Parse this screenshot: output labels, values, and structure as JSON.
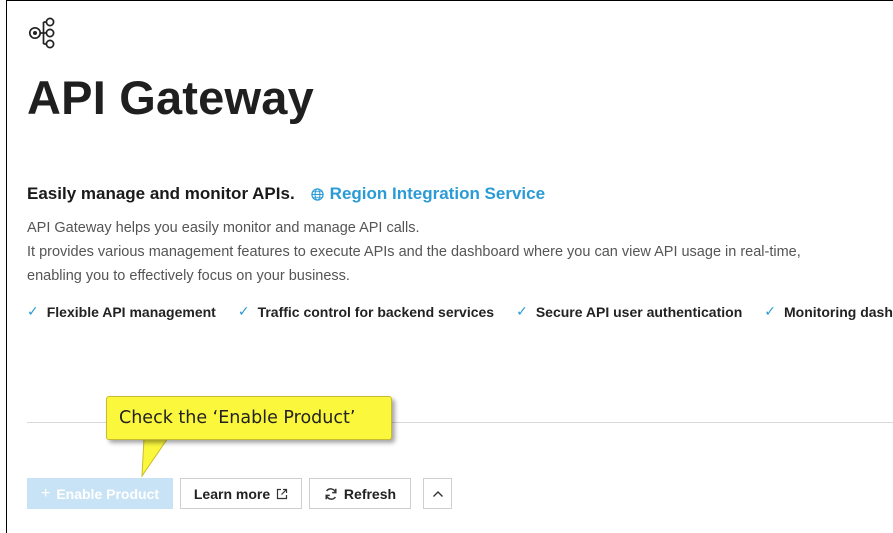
{
  "header": {
    "icon": "api-gateway-icon",
    "title": "API Gateway"
  },
  "intro": {
    "tagline": "Easily manage and monitor APIs.",
    "region_link": {
      "icon": "globe-icon",
      "label": "Region Integration Service"
    },
    "description": [
      "API Gateway helps you easily monitor and manage API calls.",
      "It provides various management features to execute APIs and the dashboard where you can view API usage in real-time,",
      "enabling you to effectively focus on your business."
    ]
  },
  "features": [
    "Flexible API management",
    "Traffic control for backend services",
    "Secure API user authentication",
    "Monitoring dashboard"
  ],
  "actions": {
    "enable_product": "Enable Product",
    "learn_more": "Learn more",
    "refresh": "Refresh",
    "collapse_icon": "chevron-up-icon"
  },
  "callout": {
    "text": "Check the ‘Enable Product’"
  },
  "colors": {
    "accent": "#2b9bd6",
    "enable_button_disabled": "#c9e3f6",
    "callout_bg": "#fbf73d"
  }
}
